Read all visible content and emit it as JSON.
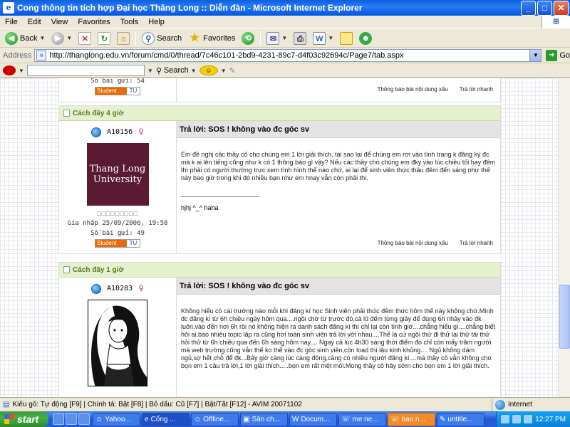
{
  "window": {
    "title": "Cong thông tin tích hợp Đại học Thăng Long :: Diễn đàn - Microsoft Internet Explorer",
    "controls": {
      "minimize": "_",
      "maximize": "□",
      "close": "✕"
    }
  },
  "menu": [
    "File",
    "Edit",
    "View",
    "Favorites",
    "Tools",
    "Help"
  ],
  "toolbar": {
    "back_label": "Back",
    "search_label": "Search",
    "favorites_label": "Favorites"
  },
  "address": {
    "label": "Address",
    "url": "http://thanglong.edu.vn/forum/cmd/0/thread/7c46c101-2bd9-4231-89c7-d4f03c92694c/Page7/tab.aspx",
    "go_label": "Go"
  },
  "search_toolbar": {
    "search_label": "Search"
  },
  "prev_post": {
    "post_count_label": "Số bài gửi: 54",
    "badge_text": "Student",
    "badge_logo": "TU",
    "actions": [
      "Thông báo bài nội dung xấu",
      "Trả lời nhanh"
    ]
  },
  "posts": [
    {
      "time": "Cách đây 4 giờ",
      "username": "A10156",
      "avatar_lines": [
        "Thang Long",
        "University"
      ],
      "stars": "□□□□□□□□□",
      "joined": "Gia nhập 25/09/2006, 19:58",
      "post_count": "Số bài gửi: 49",
      "badge_text": "Student",
      "badge_logo": "TU",
      "title": "Trả lời: SOS ! không vào đc góc sv",
      "body": "Em đề nghị các thầy cô cho chúng em 1 lời giải thích, tại sao lại để chúng em rơi vào tình trạng k đăng ký đc mà k ai lên tiếng cũng như k có 1 thông báo gì vậy? Nếu các thầy cho chúng em đky vào lúc chiều tối hay đêm thì phải có người thường trực xem tình hình thế nào chứ, ai lại để sinh viên thức thâu đêm đến sáng như thế này bao giờ trong khi đó nhiều bạn như em hnay vẫn còn phải thi.",
      "signature": "hjhj ^_^ haha",
      "actions": [
        "Thông báo bài nội dung xấu",
        "Trả lời nhanh"
      ]
    },
    {
      "time": "Cách đây 1 giờ",
      "username": "A10283",
      "title": "Trả lời: SOS ! không vào đc góc sv",
      "body": "Không hiểu có cái trường nào mỗi khi đăng kí học Sinh viên phải thức đêm thức hôm thế này không chứ.Mình đc đăng kí từ 6h chiều ngày hôm qua....ngồi chờ từ trước đó,cả lũ đếm từng giây để đúng 6h nhảy vào đk luôn,vào đến nơi 6h rồi nó không hiện ra danh sách đăng kí thì chỉ lại còn tình giờ....chẳng hiểu gì....chẳng biết hỏi ai.bao nhiêu topic lập ra cũng hơi toàn sinh viên trả lời với nhau....Thế là cứ ngồi thử đi thử lại thử tài thử hỏi thử từ 6h chiều qua đến 6h sáng hôm nay.... Ngay cả lúc 4h30 sáng thời điểm đó chỉ còn mấy trăm người mà web trường cũng vẫn thế ko thể vào đc góc sinh viên,còn load thì lâu kinh khủng.... Ngủ không dám ngủ,sợ hết chỗ để đk...Bây giờ càng lúc càng đông,càng có nhiều người đăng kí....mà thầy cô vẫn không cho bọn em 1 câu trả lời,1 lời giải thích.....bọn em rất mệt mỏi.Mong thầy cô hãy sớm cho bọn em 1 lời giải thích."
    }
  ],
  "status": {
    "text": "Kiểu gõ: Tự động [F9] | Chính tả: Bật [F8] | Bỏ dấu: Cũ [F7] | Bật/Tắt [F12] - AVIM 20071102",
    "zone": "Internet"
  },
  "taskbar": {
    "start_label": "start",
    "tasks": [
      "Yahoo...",
      "Cổng ...",
      "Offline...",
      "Sân ch...",
      "Docum...",
      "me ne...",
      "bao n...",
      "untitle..."
    ],
    "clock": "12:27 PM"
  }
}
